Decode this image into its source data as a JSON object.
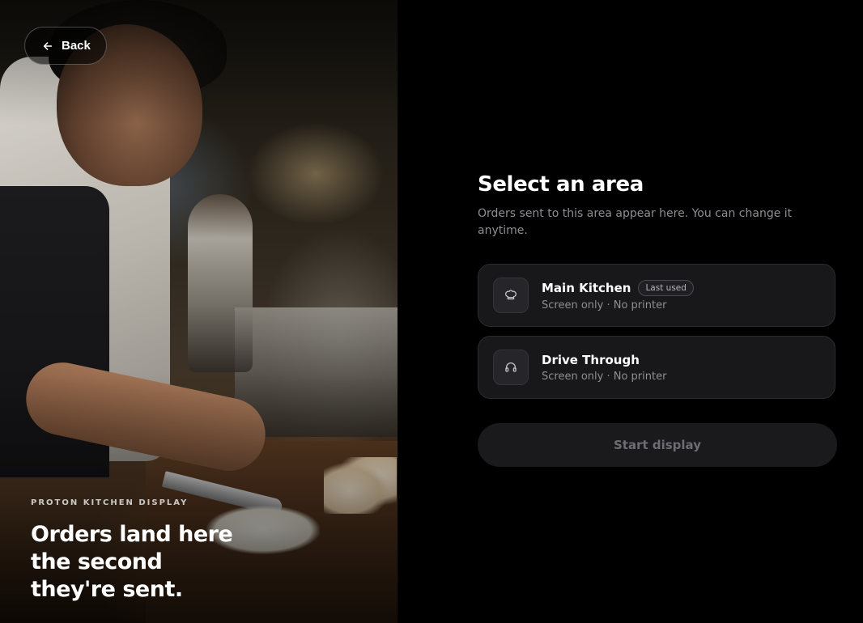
{
  "back_button": {
    "label": "Back",
    "icon": "arrow-left-icon"
  },
  "hero": {
    "eyebrow": "PROTON KITCHEN DISPLAY",
    "headline": "Orders land here the second they're sent."
  },
  "panel": {
    "title": "Select an area",
    "subtitle": "Orders sent to this area appear here. You can change it anytime.",
    "areas": [
      {
        "name": "Main Kitchen",
        "badge": "Last used",
        "description": "Screen only · No printer",
        "icon": "chef-hat-icon"
      },
      {
        "name": "Drive Through",
        "badge": "",
        "description": "Screen only · No printer",
        "icon": "headset-icon"
      }
    ],
    "start_button": "Start display"
  },
  "colors": {
    "background": "#000000",
    "card": "#18181b",
    "card_border": "#2c2c30",
    "muted_text": "#8e8e93",
    "disabled_button": "#1a1a1d"
  }
}
